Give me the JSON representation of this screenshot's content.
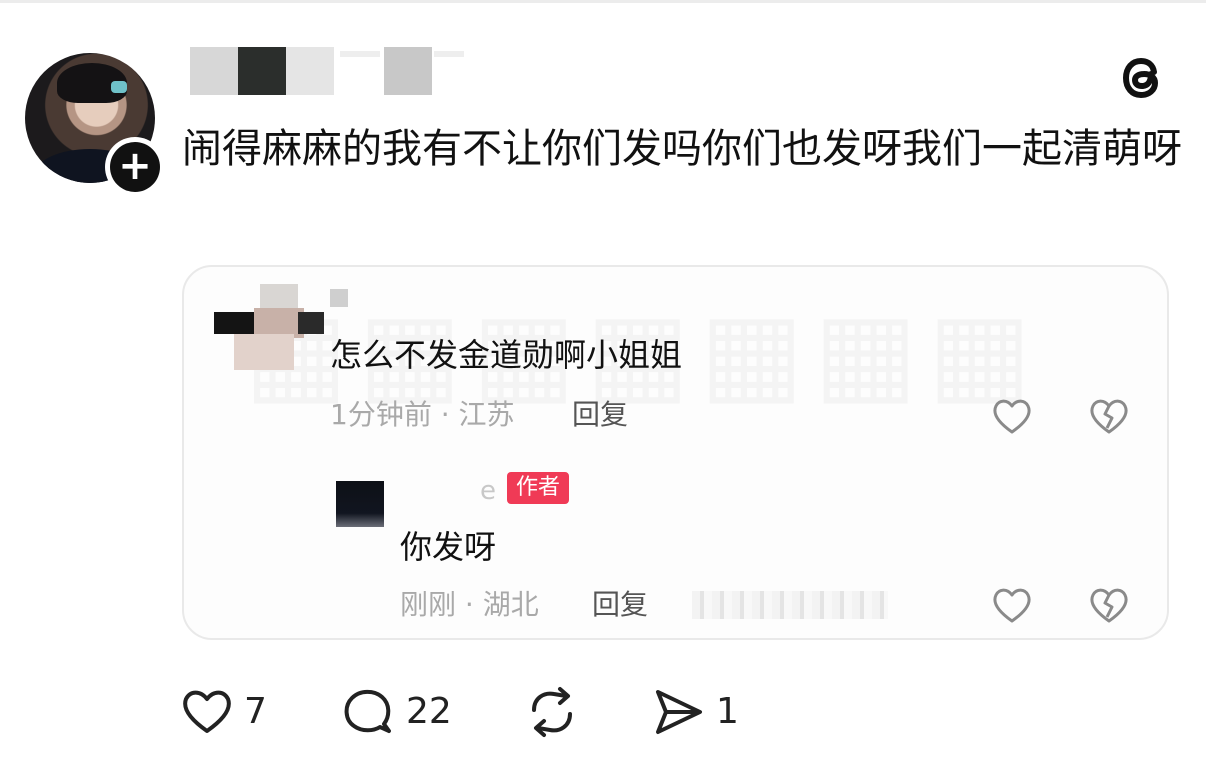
{
  "post": {
    "text": "闹得麻麻的我有不让你们发吗你们也发呀我们一起清萌呀"
  },
  "comment": {
    "text": "怎么不发金道勋啊小姐姐",
    "meta": "1分钟前 · 江苏",
    "reply_label": "回复"
  },
  "reply": {
    "name_tail": "e",
    "author_badge": "作者",
    "text": "你发呀",
    "meta": "刚刚 · 湖北",
    "reply_label": "回复"
  },
  "actions": {
    "likes": "7",
    "comments": "22",
    "shares": "1"
  },
  "colors": {
    "author_badge": "#f03a56",
    "muted_text": "#a9a9a9"
  },
  "icons": [
    "plus-icon",
    "threads-logo-icon",
    "heart-icon",
    "broken-heart-icon",
    "comment-icon",
    "repost-icon",
    "send-icon"
  ]
}
